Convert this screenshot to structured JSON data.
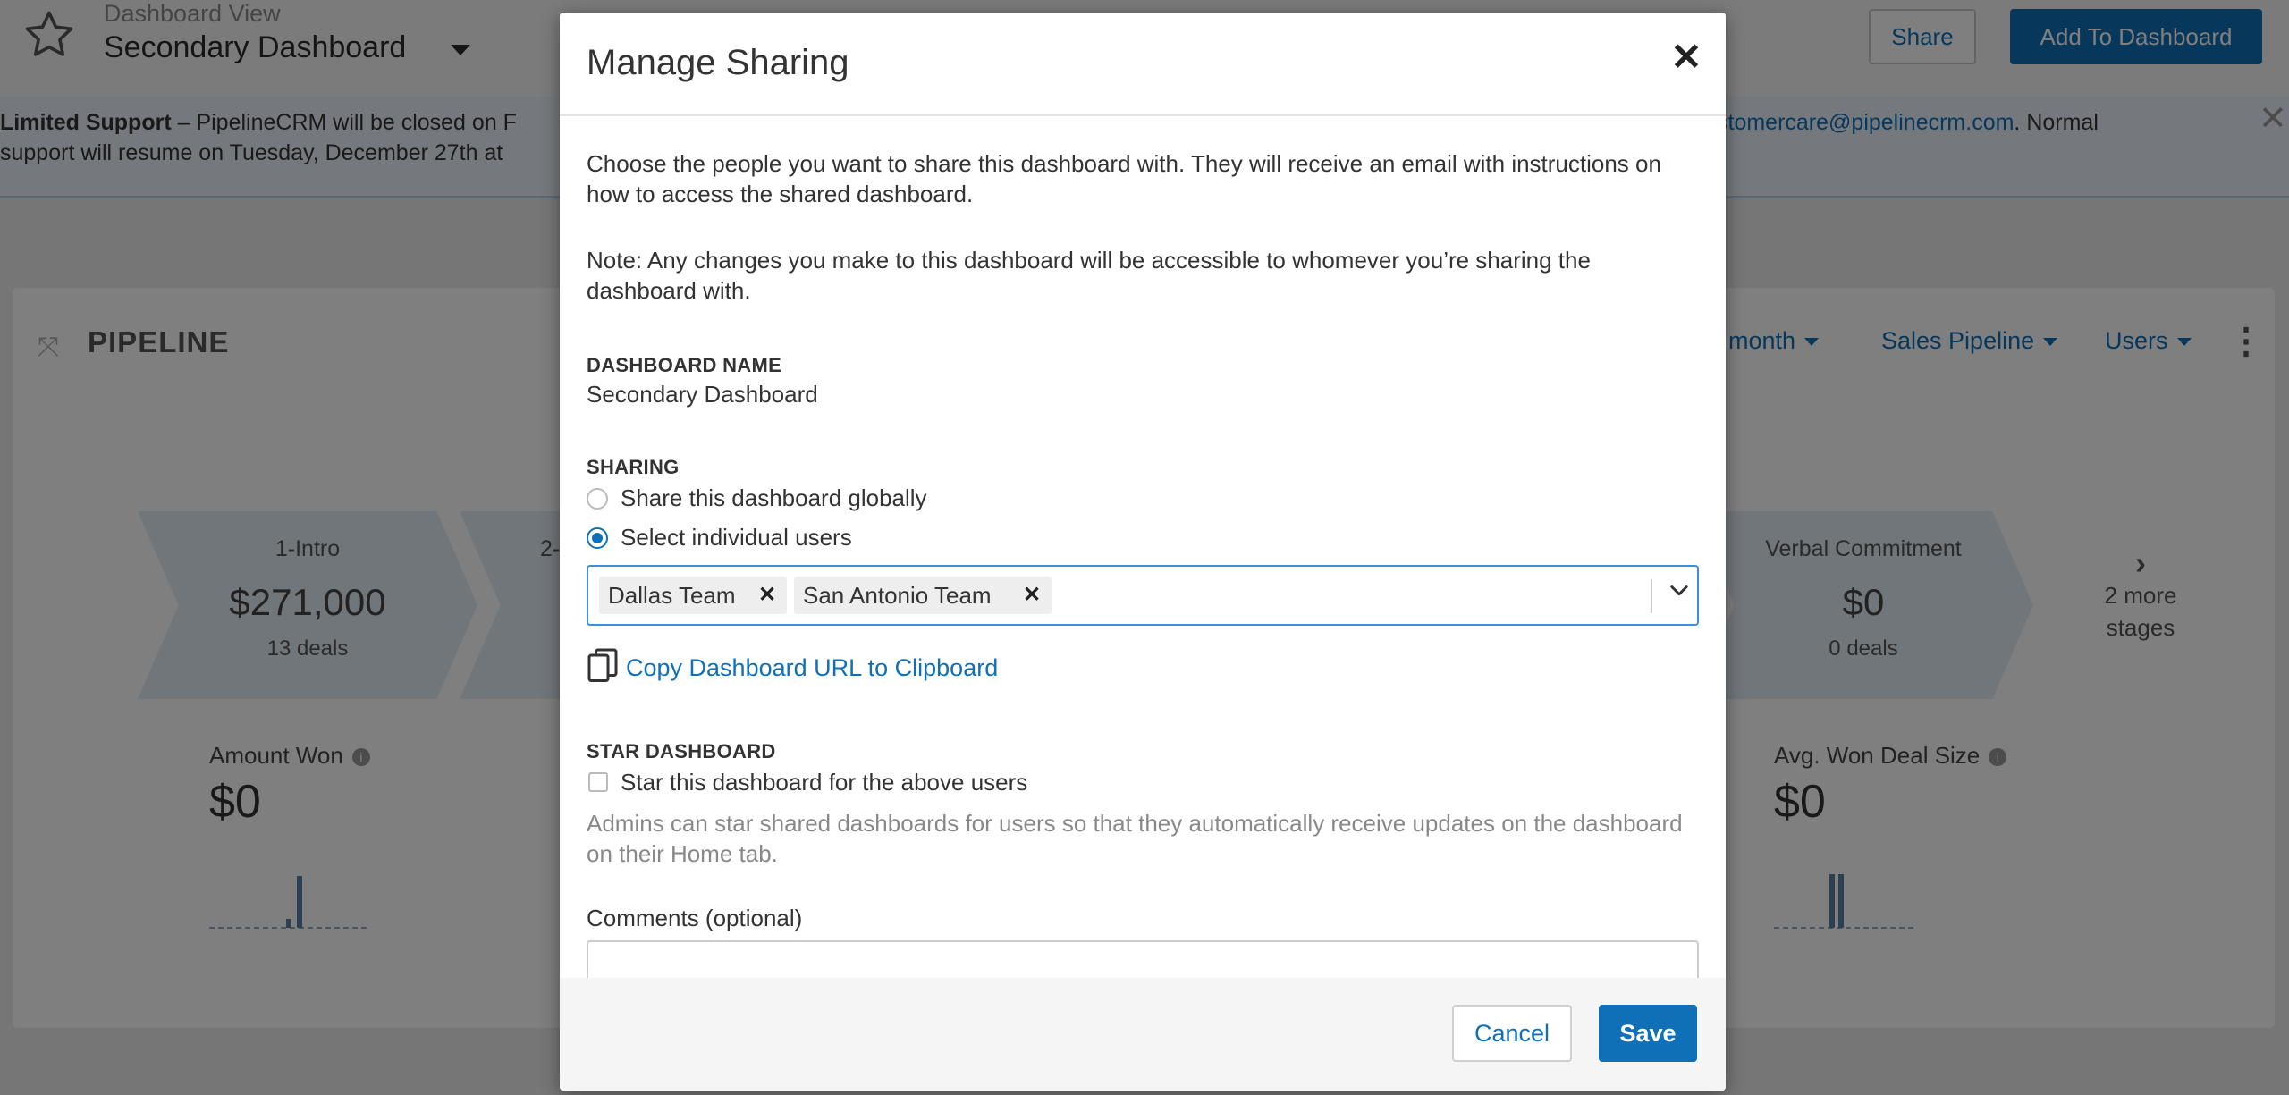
{
  "header": {
    "view_label": "Dashboard View",
    "dashboard_title": "Secondary Dashboard",
    "share_label": "Share",
    "add_label": "Add To Dashboard"
  },
  "banner": {
    "bold_text": "Limited Support",
    "text_left_1": " – PipelineCRM will be closed on F",
    "text_left_2": "support will resume on Tuesday, December 27th at",
    "email": "stomercare@pipelinecrm.com",
    "text_right": ". Normal"
  },
  "pipeline": {
    "title": "PIPELINE",
    "filters": [
      "s month",
      "Sales Pipeline",
      "Users"
    ],
    "stages": [
      {
        "name": "1-Intro",
        "value": "$271,000",
        "deals": "13 deals"
      },
      {
        "name": "2-",
        "value": "",
        "deals": ""
      },
      {
        "name": "",
        "value": "",
        "deals": ""
      },
      {
        "name": "Verbal Commitment",
        "value": "$0",
        "deals": "0 deals"
      }
    ],
    "more_stages": "2 more stages",
    "metrics": [
      {
        "label": "Amount Won",
        "value": "$0"
      },
      {
        "label": "Avg. Won Deal Size",
        "value": "$0"
      }
    ]
  },
  "modal": {
    "title": "Manage Sharing",
    "intro": "Choose the people you want to share this dashboard with. They will receive an email with instructions on how to access the shared dashboard.",
    "note": "Note: Any changes you make to this dashboard will be accessible to whomever you’re sharing the dashboard with.",
    "name_label": "DASHBOARD NAME",
    "name_value": "Secondary Dashboard",
    "sharing_label": "SHARING",
    "option_global": "Share this dashboard globally",
    "option_individual": "Select individual users",
    "selected_users": [
      "Dallas Team",
      "San Antonio Team"
    ],
    "copy_link": "Copy Dashboard URL to Clipboard",
    "star_label": "STAR DASHBOARD",
    "star_checkbox": "Star this dashboard for the above users",
    "star_hint": "Admins can star shared dashboards for users so that they automatically receive updates on the dashboard on their Home tab.",
    "comments_label": "Comments (optional)",
    "cancel_label": "Cancel",
    "save_label": "Save"
  },
  "colors": {
    "accent": "#0f6fb7",
    "overlay": "rgba(0,0,0,0.5)"
  }
}
